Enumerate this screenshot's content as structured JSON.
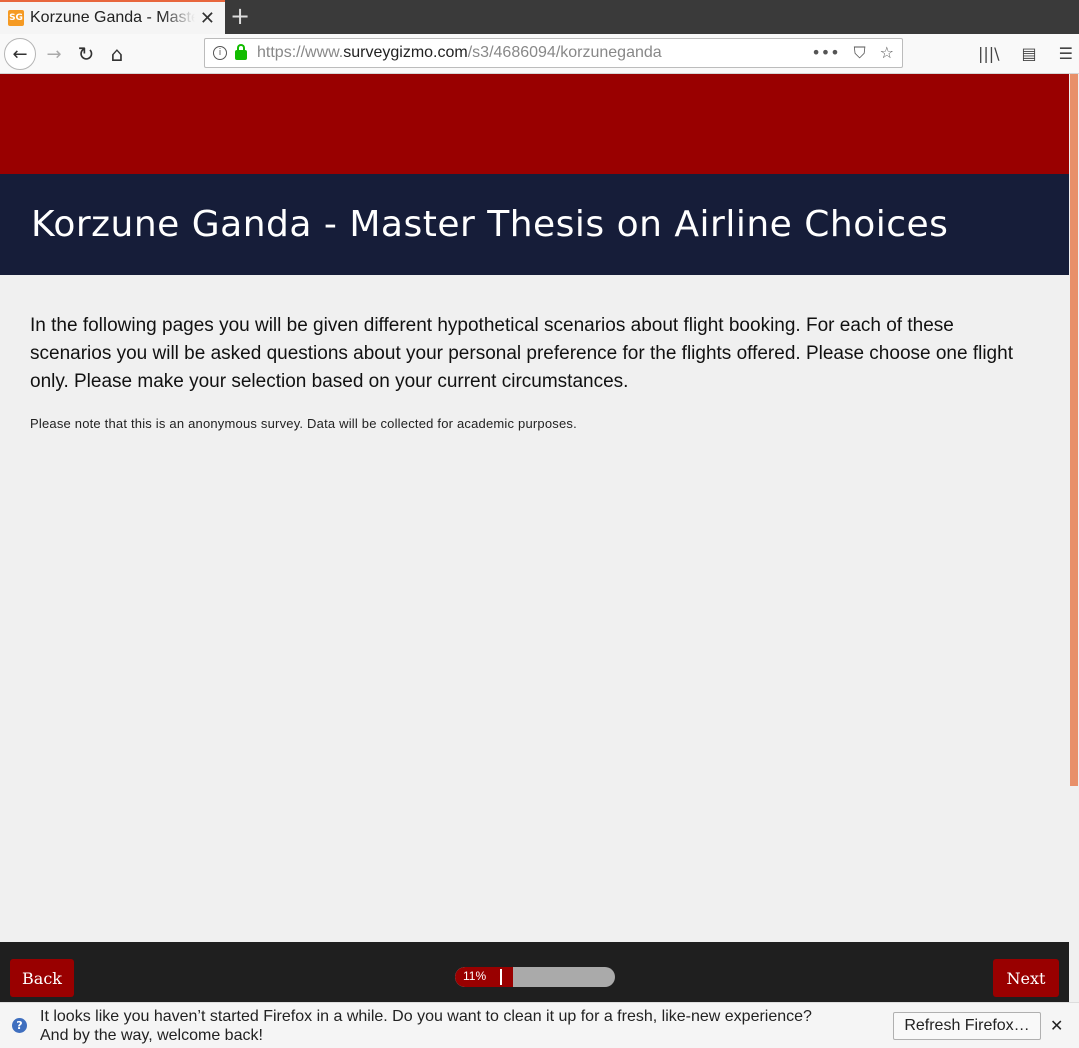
{
  "browser": {
    "tab_title": "Korzune Ganda - Master Thesis on Airline Choices",
    "favicon_text": "SG",
    "tab_close": "✕",
    "new_tab": "+",
    "url_prefix": "https://www.",
    "url_domain": "surveygizmo.com",
    "url_path": "/s3/4686094/korzuneganda",
    "nav_back": "←",
    "nav_forward": "→",
    "nav_reload": "↻",
    "nav_home": "⌂",
    "info_icon": "i",
    "more_icon": "•••",
    "pocket_icon": "⛉",
    "bookmark_icon": "☆",
    "library_icon": "|||\\",
    "sidebar_icon": "▤",
    "menu_icon": "☰"
  },
  "survey": {
    "title": "Korzune Ganda - Master Thesis on Airline Choices",
    "intro": "In the following pages you will be given different hypothetical scenarios about flight booking. For each of these scenarios you will be asked questions about your personal preference for the flights offered. Please choose one flight only. Please make your selection based on your current circumstances.",
    "note": "Please note that this is an anonymous survey. Data will be collected for academic purposes.",
    "back_label": "Back",
    "next_label": "Next",
    "progress_label": "11%",
    "progress_value": 0.11
  },
  "notification": {
    "message": "It looks like you haven’t started Firefox in a while. Do you want to clean it up for a fresh, like-new experience? And by the way, welcome back!",
    "refresh_label": "Refresh Firefox…",
    "close": "✕",
    "help_icon": "?"
  },
  "colors": {
    "brand_red": "#990000",
    "header_navy": "#161d39"
  }
}
